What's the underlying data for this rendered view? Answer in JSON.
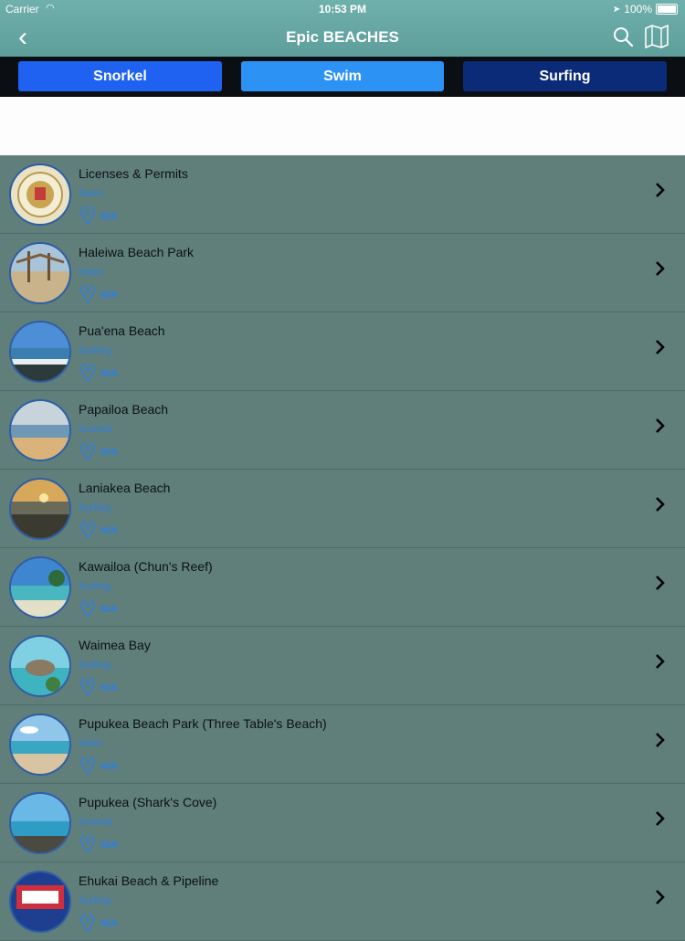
{
  "status_bar": {
    "carrier": "Carrier",
    "time": "10:53 PM",
    "battery": "100%"
  },
  "nav": {
    "title": "Epic BEACHES"
  },
  "segments": [
    "Snorkel",
    "Swim",
    "Surfing"
  ],
  "beaches": [
    {
      "name": "Licenses & Permits",
      "category": "Swim",
      "location": "N/A"
    },
    {
      "name": "Haleiwa Beach Park",
      "category": "Swim",
      "location": "N/A"
    },
    {
      "name": "Pua'ena Beach",
      "category": "Surfing",
      "location": "N/A"
    },
    {
      "name": "Papailoa Beach",
      "category": "Snorkel",
      "location": "N/A"
    },
    {
      "name": "Laniakea Beach",
      "category": "Surfing",
      "location": "N/A"
    },
    {
      "name": "Kawailoa (Chun's Reef)",
      "category": "Surfing",
      "location": "N/A"
    },
    {
      "name": "Waimea Bay",
      "category": "Surfing",
      "location": "N/A"
    },
    {
      "name": "Pupukea Beach Park (Three Table's Beach)",
      "category": "Swim",
      "location": "N/A"
    },
    {
      "name": "Pupukea (Shark's Cove)",
      "category": "Snorkel",
      "location": "N/A"
    },
    {
      "name": "Ehukai Beach & Pipeline",
      "category": "Surfing",
      "location": "N/A"
    }
  ],
  "colors": {
    "snorkel": "#1f62f2",
    "swim": "#2c93f4",
    "surfing": "#0b2a78",
    "list_background": "#607f7a",
    "accent": "#2c7ee6"
  }
}
